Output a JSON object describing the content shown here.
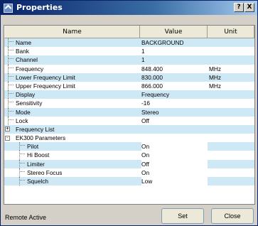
{
  "window": {
    "title": "Properties",
    "help_label": "?",
    "close_label": "X"
  },
  "table": {
    "columns": {
      "name": "Name",
      "value": "Value",
      "unit": "Unit"
    },
    "rows": [
      {
        "name": "Name",
        "value": "BACKGROUND",
        "unit": "",
        "level": 1,
        "expander": ""
      },
      {
        "name": "Bank",
        "value": "1",
        "unit": "",
        "level": 1,
        "expander": ""
      },
      {
        "name": "Channel",
        "value": "1",
        "unit": "",
        "level": 1,
        "expander": ""
      },
      {
        "name": "Frequency",
        "value": "848.400",
        "unit": "MHz",
        "level": 1,
        "expander": ""
      },
      {
        "name": "Lower Frequency Limit",
        "value": "830.000",
        "unit": "MHz",
        "level": 1,
        "expander": ""
      },
      {
        "name": "Upper Frequency Limit",
        "value": "866.000",
        "unit": "MHz",
        "level": 1,
        "expander": ""
      },
      {
        "name": "Display",
        "value": "Frequency",
        "unit": "",
        "level": 1,
        "expander": ""
      },
      {
        "name": "Sensitivity",
        "value": "-16",
        "unit": "",
        "level": 1,
        "expander": ""
      },
      {
        "name": "Mode",
        "value": "Stereo",
        "unit": "",
        "level": 1,
        "expander": ""
      },
      {
        "name": "Lock",
        "value": "Off",
        "unit": "",
        "level": 1,
        "expander": ""
      },
      {
        "name": "Frequency List",
        "value": "",
        "unit": "",
        "level": 0,
        "expander": "+"
      },
      {
        "name": "EK300 Parameters",
        "value": "",
        "unit": "",
        "level": 0,
        "expander": "-"
      },
      {
        "name": "Pilot",
        "value": "On",
        "unit": "",
        "level": 2,
        "expander": ""
      },
      {
        "name": "Hi Boost",
        "value": "On",
        "unit": "",
        "level": 2,
        "expander": ""
      },
      {
        "name": "Limiter",
        "value": "Off",
        "unit": "",
        "level": 2,
        "expander": ""
      },
      {
        "name": "Stereo Focus",
        "value": "On",
        "unit": "",
        "level": 2,
        "expander": ""
      },
      {
        "name": "Squelch",
        "value": "Low",
        "unit": "",
        "level": 2,
        "expander": ""
      }
    ]
  },
  "status": {
    "text": "Remote Active"
  },
  "buttons": {
    "set": "Set",
    "close": "Close"
  },
  "colors": {
    "band": "#cfe8f5",
    "title_start": "#0a246a"
  }
}
